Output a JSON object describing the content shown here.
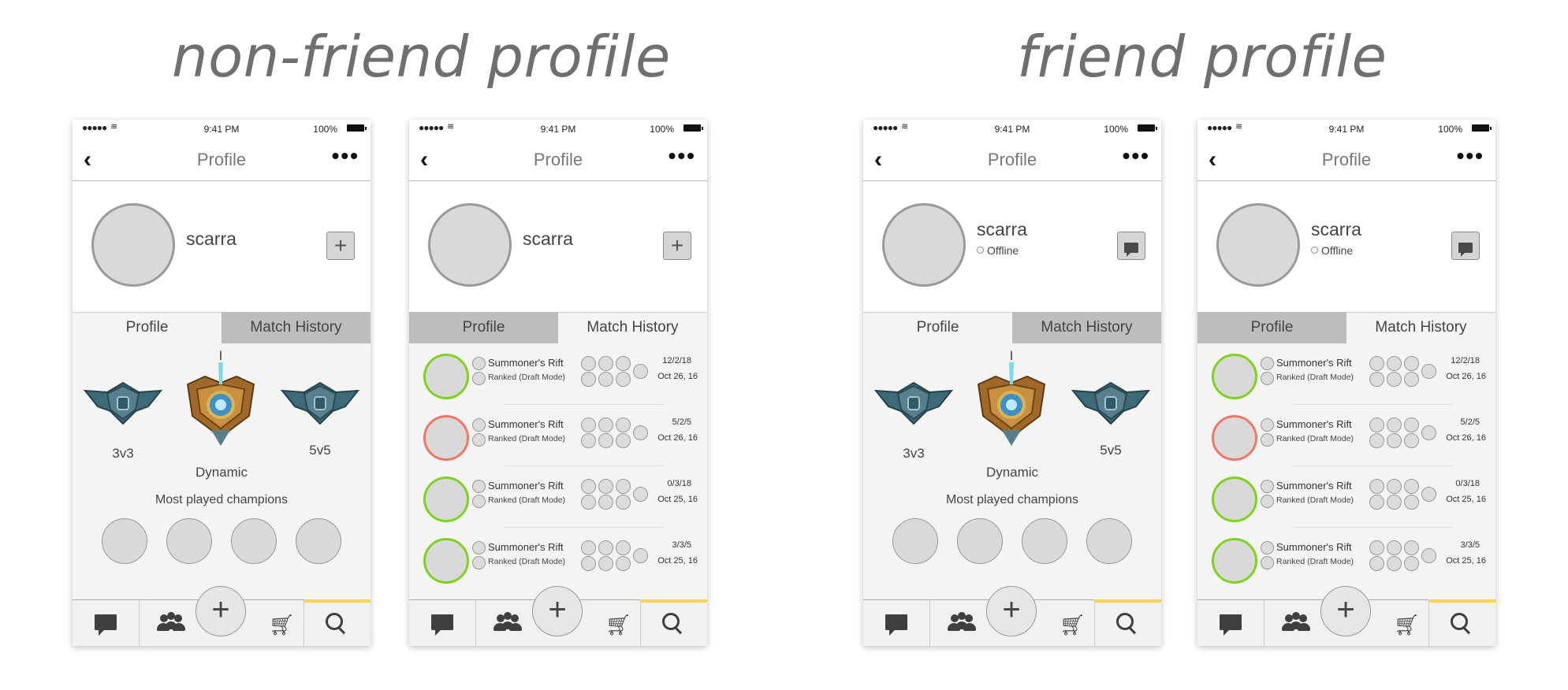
{
  "sections": {
    "non_friend_title": "non-friend profile",
    "friend_title": "friend profile"
  },
  "status_bar": {
    "signal": "●●●●●",
    "wifi": "≋",
    "time": "9:41 PM",
    "battery": "100%"
  },
  "nav": {
    "title": "Profile"
  },
  "user": {
    "name": "scarra",
    "status": "Offline"
  },
  "tabs": {
    "profile": "Profile",
    "match_history": "Match History"
  },
  "ranks": {
    "top_marker": "I",
    "left": "3v3",
    "center": "Dynamic",
    "right": "5v5"
  },
  "champions": {
    "label": "Most played champions"
  },
  "matches": [
    {
      "result": "win",
      "mode": "Summoner's Rift",
      "queue": "Ranked (Draft Mode)",
      "kda": "12/2/18",
      "date": "Oct 26, 16"
    },
    {
      "result": "loss",
      "mode": "Summoner's Rift",
      "queue": "Ranked (Draft Mode)",
      "kda": "5/2/5",
      "date": "Oct 26, 16"
    },
    {
      "result": "win",
      "mode": "Summoner's Rift",
      "queue": "Ranked (Draft Mode)",
      "kda": "0/3/18",
      "date": "Oct 25, 16"
    },
    {
      "result": "win",
      "mode": "Summoner's Rift",
      "queue": "Ranked (Draft Mode)",
      "kda": "3/3/5",
      "date": "Oct 25, 16"
    }
  ],
  "tabbar": {
    "active": "search",
    "plus": "+"
  },
  "colors": {
    "win": "#7ed321",
    "loss": "#f1776b",
    "active_tab": "#f8d64e",
    "title": "#6f6f6f"
  }
}
